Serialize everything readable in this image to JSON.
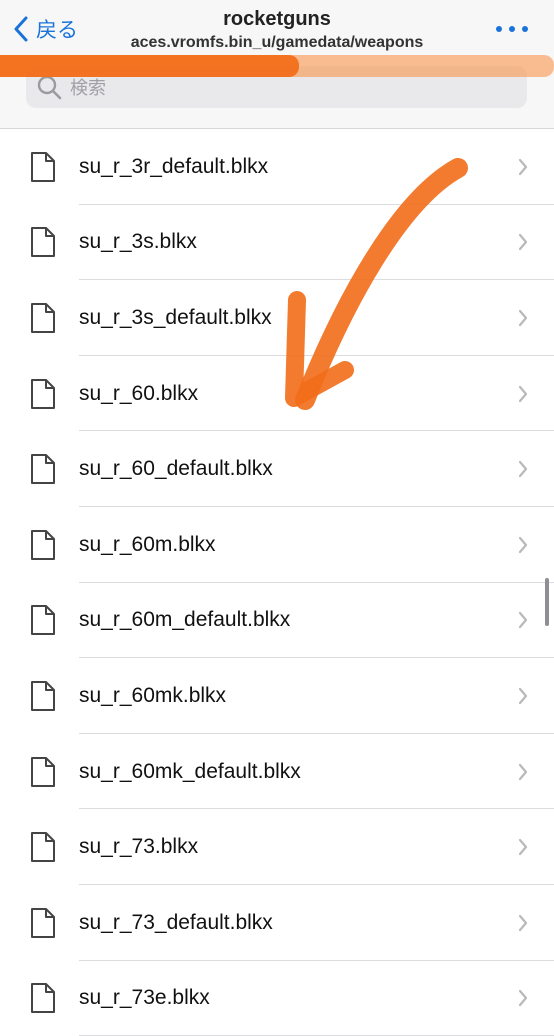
{
  "header": {
    "back_label": "戻る",
    "title": "rocketguns",
    "subtitle": "aces.vromfs.bin_u/gamedata/weapons"
  },
  "search": {
    "placeholder": "検索"
  },
  "progress": {
    "fraction": 0.54
  },
  "files": [
    {
      "name": "su_r_3r_default.blkx"
    },
    {
      "name": "su_r_3s.blkx"
    },
    {
      "name": "su_r_3s_default.blkx"
    },
    {
      "name": "su_r_60.blkx"
    },
    {
      "name": "su_r_60_default.blkx"
    },
    {
      "name": "su_r_60m.blkx"
    },
    {
      "name": "su_r_60m_default.blkx"
    },
    {
      "name": "su_r_60mk.blkx"
    },
    {
      "name": "su_r_60mk_default.blkx"
    },
    {
      "name": "su_r_73.blkx"
    },
    {
      "name": "su_r_73_default.blkx"
    },
    {
      "name": "su_r_73e.blkx"
    }
  ],
  "colors": {
    "accent": "#1a73d9",
    "annotation": "#f26d18"
  },
  "icons": {
    "back": "chevron-left-icon",
    "more": "ellipsis-icon",
    "search": "magnifier-icon",
    "file": "document-icon",
    "row_disclosure": "chevron-right-icon"
  }
}
